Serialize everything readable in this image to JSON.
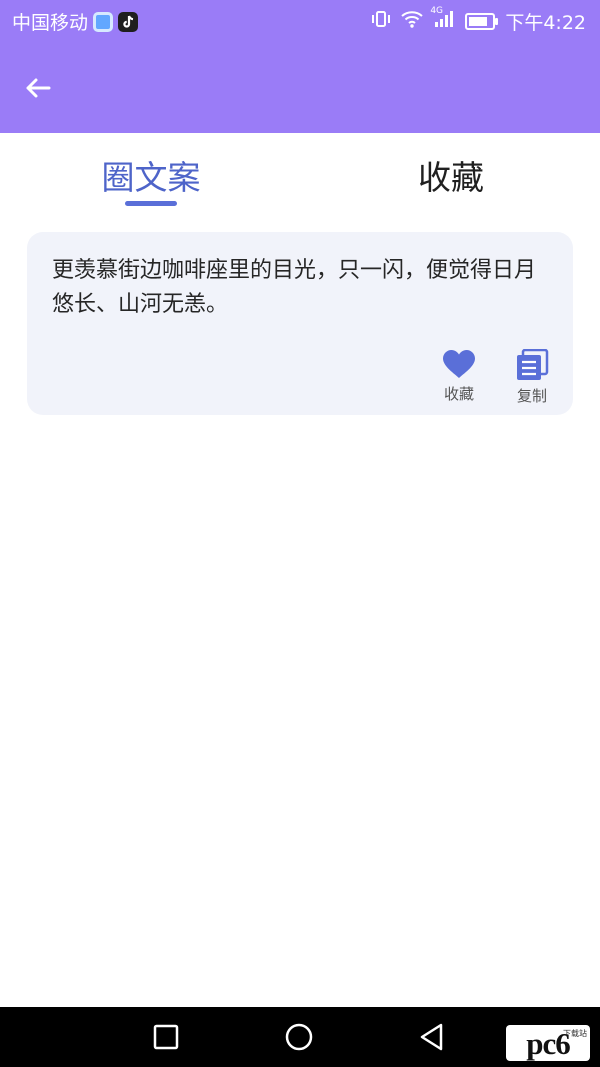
{
  "status_bar": {
    "carrier": "中国移动",
    "time": "下午4:22",
    "network": "4G"
  },
  "header": {
    "back_icon": "arrow-left-icon"
  },
  "tabs": [
    {
      "label": "圈文案",
      "active": true
    },
    {
      "label": "收藏",
      "active": false
    }
  ],
  "cards": [
    {
      "text": "更羡慕街边咖啡座里的目光，只一闪，便觉得日月悠长、山河无恙。",
      "actions": {
        "favorite_label": "收藏",
        "copy_label": "复制"
      }
    }
  ],
  "watermark": {
    "brand": "pc6",
    "sub": "下载站"
  },
  "colors": {
    "header_bg": "#9a7cf7",
    "tab_active": "#4e64c9",
    "card_bg": "#f1f3fa",
    "icon_blue": "#5a6fd8"
  },
  "nav_bar": {
    "icons": [
      "recent-apps-icon",
      "home-icon",
      "back-icon"
    ]
  }
}
